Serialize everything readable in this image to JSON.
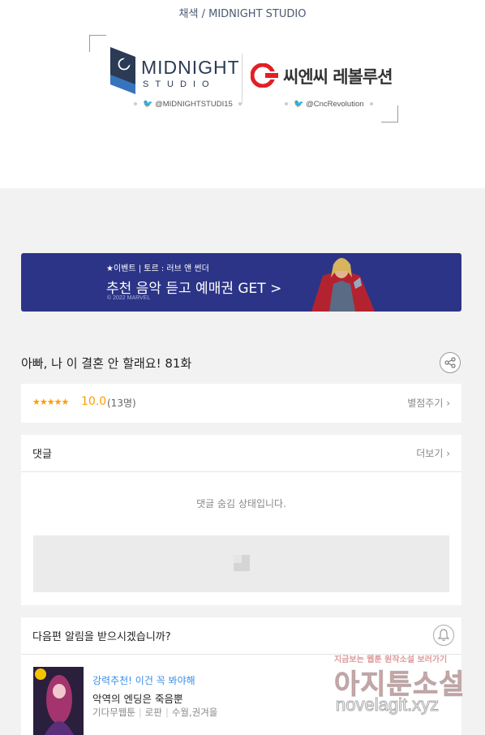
{
  "credits": {
    "line": "채색 / MIDNIGHT STUDIO",
    "midnight_word": "MIDNIGHT",
    "midnight_sub": "STUDIO",
    "midnight_handle": "@MIDNIGHTSTUDI15",
    "cnc_word": "씨엔씨 레볼루션",
    "cnc_handle": "@CncRevolution"
  },
  "banner": {
    "subtitle": "★이벤트 | 토르 : 러브 앤 썬더",
    "title": "추천 음악 듣고 예매권 GET >",
    "copyright": "© 2022 MARVEL"
  },
  "episode": {
    "title": "아빠, 나 이 결혼 안 할래요! 81화"
  },
  "rating": {
    "stars": "★★★★★",
    "score": "10.0",
    "count": "(13명)",
    "action": "별점주기 ›"
  },
  "comments": {
    "title": "댓글",
    "more": "더보기 ›",
    "hidden_message": "댓글 숨김 상태입니다."
  },
  "notify": {
    "title": "다음편 알림을 받으시겠습니까?",
    "recommend_label": "강력추천! 이건 꼭 봐야해",
    "rec_title": "악역의 엔딩은 죽음뿐",
    "rec_meta": [
      "기다무웹툰",
      "로판",
      "수월,권겨을"
    ]
  },
  "watermark": {
    "tagline": "지금보는 웹툰 원작소설 보러가기",
    "name": "아지툰소설",
    "url": "novelagit.xyz"
  },
  "colors": {
    "banner_bg": "#2c3487",
    "star": "#ff9c00",
    "link_blue": "#3a8ee6"
  }
}
